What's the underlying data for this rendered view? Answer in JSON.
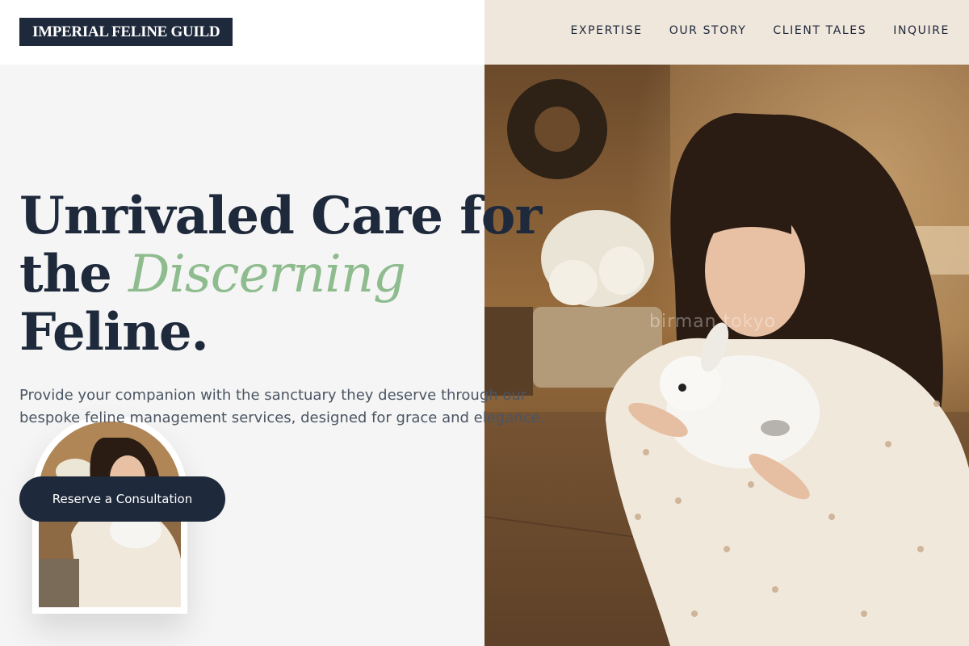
{
  "header": {
    "logo": "IMPERIAL FELINE GUILD",
    "nav": [
      "EXPERTISE",
      "OUR STORY",
      "CLIENT TALES",
      "INQUIRE"
    ]
  },
  "hero": {
    "title_line1": "Unrivaled Care for",
    "title_line2_prefix": "the ",
    "title_accent": "Discerning",
    "title_line3": "Feline.",
    "description": "Provide your companion with the sanctuary they deserve through our bespoke feline management services, designed for grace and elegance.",
    "cta_label": "Reserve a Consultation"
  },
  "photo": {
    "watermark": "birman.tokyo"
  },
  "colors": {
    "primary": "#1e293b",
    "accent": "#8fbc8f",
    "text_muted": "#4b5563",
    "background": "#f5f5f5"
  }
}
